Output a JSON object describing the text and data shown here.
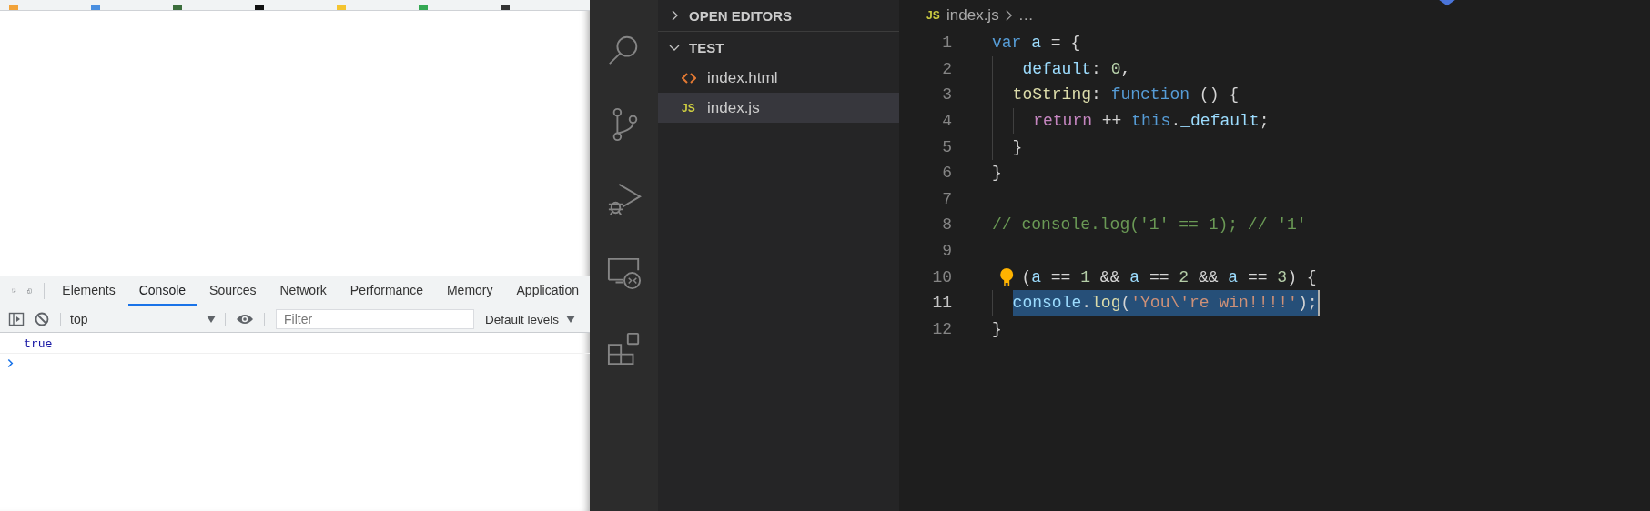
{
  "devtools": {
    "tabs": [
      {
        "label": "Elements",
        "selected": false
      },
      {
        "label": "Console",
        "selected": true
      },
      {
        "label": "Sources",
        "selected": false
      },
      {
        "label": "Network",
        "selected": false
      },
      {
        "label": "Performance",
        "selected": false
      },
      {
        "label": "Memory",
        "selected": false
      },
      {
        "label": "Application",
        "selected": false
      }
    ],
    "context": "top",
    "filter": {
      "placeholder": "Filter"
    },
    "levels": "Default levels",
    "output": [
      "true"
    ]
  },
  "explorer": {
    "sections": [
      {
        "title": "OPEN EDITORS",
        "expanded": false
      },
      {
        "title": "TEST",
        "expanded": true
      }
    ],
    "files": [
      {
        "name": "index.html",
        "kind": "html",
        "selected": false
      },
      {
        "name": "index.js",
        "kind": "js",
        "badge": "JS",
        "selected": true
      }
    ]
  },
  "editor": {
    "breadcrumb": {
      "badge": "JS",
      "file": "index.js",
      "rest": "…"
    },
    "lines": [
      {
        "number": "1",
        "current": false,
        "tokens": [
          {
            "text": "var ",
            "kind": "keyword"
          },
          {
            "text": "a",
            "kind": "variable"
          },
          {
            "text": " = {",
            "kind": "punct"
          }
        ]
      },
      {
        "number": "2",
        "current": false,
        "tokens": [
          {
            "text": "  _default",
            "kind": "variable"
          },
          {
            "text": ": ",
            "kind": "punct"
          },
          {
            "text": "0",
            "kind": "number"
          },
          {
            "text": ",",
            "kind": "punct"
          }
        ]
      },
      {
        "number": "3",
        "current": false,
        "tokens": [
          {
            "text": "  toString",
            "kind": "function"
          },
          {
            "text": ": ",
            "kind": "punct"
          },
          {
            "text": "function",
            "kind": "keyword"
          },
          {
            "text": " () {",
            "kind": "punct"
          }
        ]
      },
      {
        "number": "4",
        "current": false,
        "tokens": [
          {
            "text": "    return",
            "kind": "control"
          },
          {
            "text": " ++ ",
            "kind": "punct"
          },
          {
            "text": "this",
            "kind": "keyword"
          },
          {
            "text": ".",
            "kind": "punct"
          },
          {
            "text": "_default",
            "kind": "variable"
          },
          {
            "text": ";",
            "kind": "punct"
          }
        ]
      },
      {
        "number": "5",
        "current": false,
        "tokens": [
          {
            "text": "  }",
            "kind": "punct"
          }
        ]
      },
      {
        "number": "6",
        "current": false,
        "tokens": [
          {
            "text": "}",
            "kind": "punct"
          }
        ]
      },
      {
        "number": "7",
        "current": false
      },
      {
        "number": "8",
        "current": false,
        "tokens": [
          {
            "text": "// console.log('1' == 1); // '1'",
            "kind": "comment"
          }
        ]
      },
      {
        "number": "9",
        "current": false
      },
      {
        "number": "10",
        "current": false,
        "lightbulb": true,
        "tokens": [
          {
            "text": "(",
            "kind": "punct"
          },
          {
            "text": "a",
            "kind": "variable"
          },
          {
            "text": " == ",
            "kind": "punct"
          },
          {
            "text": "1",
            "kind": "number"
          },
          {
            "text": " && ",
            "kind": "punct"
          },
          {
            "text": "a",
            "kind": "variable"
          },
          {
            "text": " == ",
            "kind": "punct"
          },
          {
            "text": "2",
            "kind": "number"
          },
          {
            "text": " && ",
            "kind": "punct"
          },
          {
            "text": "a",
            "kind": "variable"
          },
          {
            "text": " == ",
            "kind": "punct"
          },
          {
            "text": "3",
            "kind": "number"
          },
          {
            "text": ") {",
            "kind": "punct"
          }
        ]
      },
      {
        "number": "11",
        "current": true,
        "selected": true,
        "tokens": [
          {
            "text": "  console",
            "kind": "variable"
          },
          {
            "text": ".",
            "kind": "punct"
          },
          {
            "text": "log",
            "kind": "function"
          },
          {
            "text": "(",
            "kind": "punct"
          },
          {
            "text": "'You\\'re win!!!!'",
            "kind": "string"
          },
          {
            "text": ");",
            "kind": "punct"
          }
        ]
      },
      {
        "number": "12",
        "current": false,
        "tokens": [
          {
            "text": "}",
            "kind": "punct"
          }
        ]
      }
    ]
  }
}
